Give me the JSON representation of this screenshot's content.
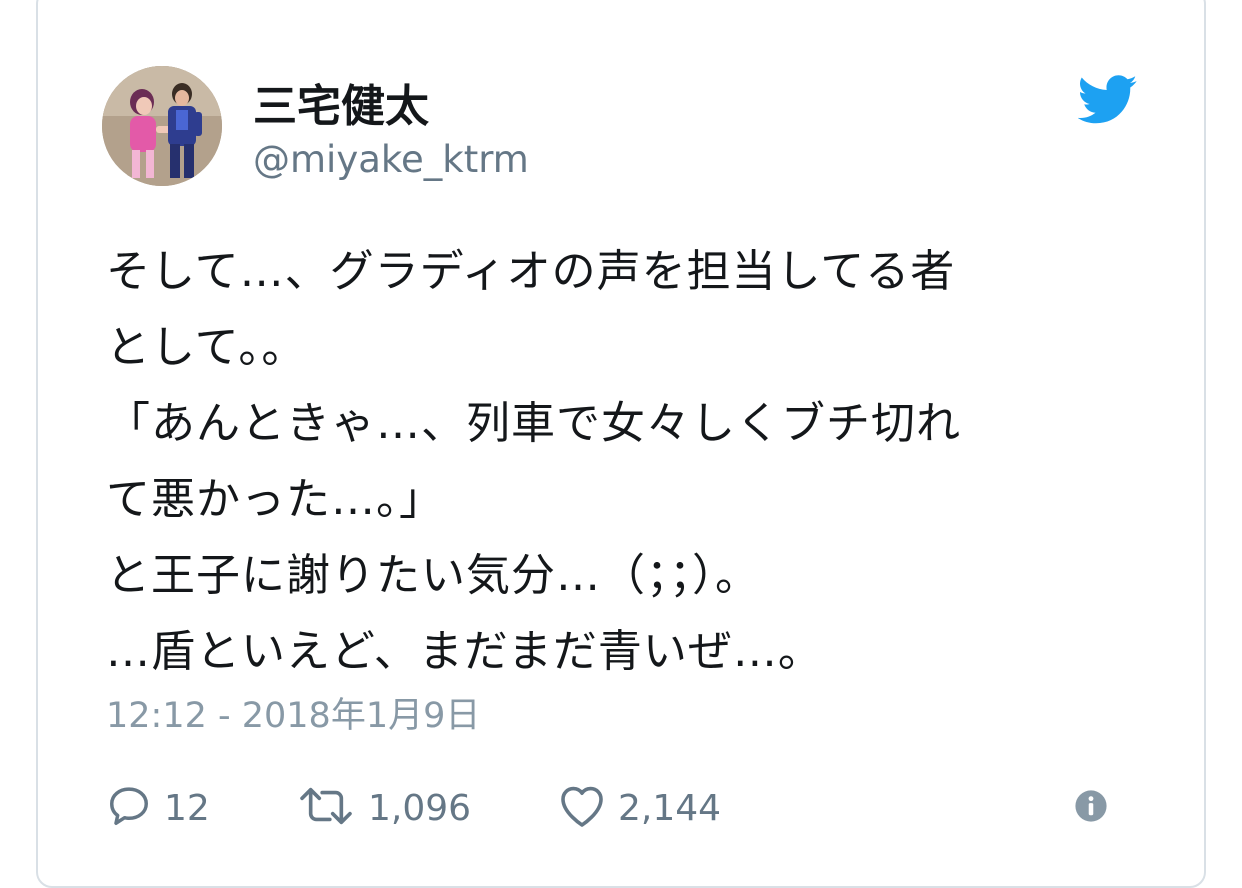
{
  "user": {
    "display_name": "三宅健太",
    "handle": "@miyake_ktrm"
  },
  "icons": {
    "logo": "twitter-bird-icon",
    "reply": "reply-icon",
    "retweet": "retweet-icon",
    "like": "heart-icon",
    "info": "info-icon"
  },
  "tweet": {
    "text": "そして…、グラディオの声を担当してる者\nとして。。\n「あんときゃ…、列車で女々しくブチ切れ\nて悪かった…。」\nと王子に謝りたい気分…（；；）。\n…盾といえど、まだまだ青いぜ…。",
    "timestamp": "12:12 - 2018年1月9日"
  },
  "stats": {
    "replies": "12",
    "retweets": "1,096",
    "likes": "2,144"
  },
  "colors": {
    "twitter_blue": "#1da1f2",
    "text": "#14171a",
    "secondary": "#657786",
    "muted": "#8899a6",
    "border": "#d9e0e6"
  }
}
